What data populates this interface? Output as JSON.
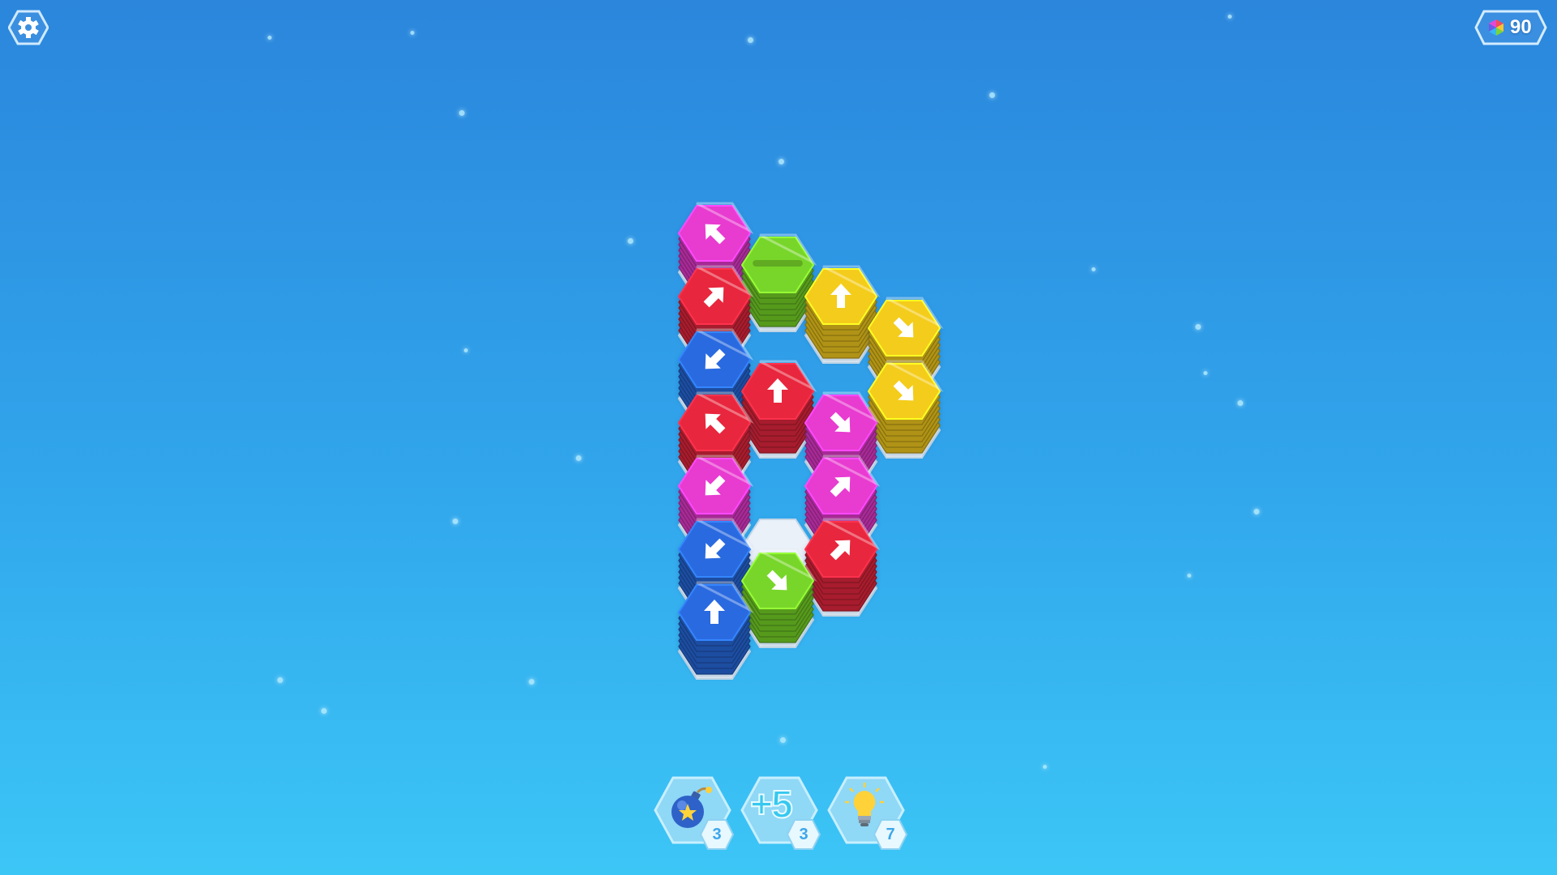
{
  "hud": {
    "settings_icon": "gear-icon",
    "currency": {
      "icon": "rainbow-gem-icon",
      "amount": "90"
    }
  },
  "colors": {
    "magenta": "#e83ad0",
    "red": "#e8283e",
    "blue": "#2a6be0",
    "green": "#78d62a",
    "yellow": "#f4cc1c",
    "empty": "#e6eef6"
  },
  "board": {
    "stacks": [
      {
        "col": 0,
        "row": 0,
        "color": "magenta",
        "arrow": "up-left"
      },
      {
        "col": 0,
        "row": 1,
        "color": "red",
        "arrow": "up-right"
      },
      {
        "col": 0,
        "row": 2,
        "color": "blue",
        "arrow": "down-left"
      },
      {
        "col": 0,
        "row": 3,
        "color": "red",
        "arrow": "up-left"
      },
      {
        "col": 0,
        "row": 4,
        "color": "magenta",
        "arrow": "down-left"
      },
      {
        "col": 0,
        "row": 5,
        "color": "blue",
        "arrow": "down-left"
      },
      {
        "col": 0,
        "row": 6,
        "color": "blue",
        "arrow": "up"
      },
      {
        "col": 1,
        "row": 0,
        "color": "green",
        "arrow": "none"
      },
      {
        "col": 1,
        "row": 2,
        "color": "red",
        "arrow": "up"
      },
      {
        "col": 1,
        "row": 4,
        "color": "empty",
        "arrow": "none"
      },
      {
        "col": 1,
        "row": 5,
        "color": "green",
        "arrow": "down-right"
      },
      {
        "col": 2,
        "row": 0,
        "color": "yellow",
        "arrow": "up"
      },
      {
        "col": 2,
        "row": 2,
        "color": "magenta",
        "arrow": "down-right"
      },
      {
        "col": 2,
        "row": 3,
        "color": "magenta",
        "arrow": "up-right"
      },
      {
        "col": 2,
        "row": 4,
        "color": "red",
        "arrow": "up-right"
      },
      {
        "col": 3,
        "row": 0,
        "color": "yellow",
        "arrow": "down-right"
      },
      {
        "col": 3,
        "row": 1,
        "color": "yellow",
        "arrow": "down-right"
      }
    ]
  },
  "powerups": [
    {
      "name": "bomb",
      "icon": "bomb-icon",
      "count": "3"
    },
    {
      "name": "plus-five",
      "label": "+5",
      "count": "3"
    },
    {
      "name": "hint",
      "icon": "lightbulb-icon",
      "count": "7"
    }
  ]
}
